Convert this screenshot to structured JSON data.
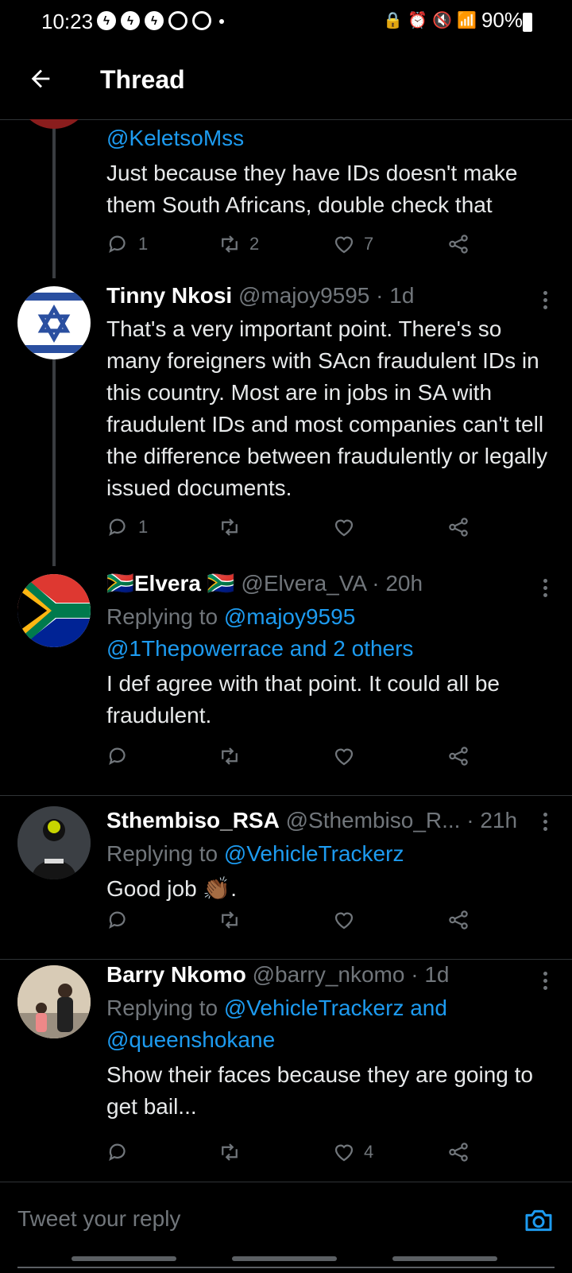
{
  "status": {
    "time": "10:23",
    "battery": "90%"
  },
  "header": {
    "title": "Thread"
  },
  "tweets": [
    {
      "reply_to": "@KeletsoMss",
      "body": "Just because they have IDs doesn't make them South Africans, double check that",
      "replies": "1",
      "retweets": "2",
      "likes": "7"
    },
    {
      "name": "Tinny Nkosi",
      "handle_time": "@majoy9595 · 1d",
      "body": "That's a very important point. There's so many foreigners with SAcn fraudulent IDs in this country. Most are in jobs in SA with fraudulent IDs and most companies can't tell the difference between fraudulently or legally issued documents.",
      "replies": "1",
      "retweets": "",
      "likes": ""
    },
    {
      "name": "Elvera",
      "handle_time": "@Elvera_VA · 20h",
      "reply_prefix": "Replying to ",
      "reply_link1": "@majoy9595",
      "reply_link2": "@1Thepowerrace and 2 others",
      "body": "I def agree with that point. It could all be fraudulent.",
      "replies": "",
      "retweets": "",
      "likes": ""
    },
    {
      "name": "Sthembiso_RSA",
      "handle_time": "@Sthembiso_R... · 21h",
      "reply_prefix": "Replying to ",
      "reply_link1": "@VehicleTrackerz",
      "body": "Good job 👏🏾.",
      "replies": "",
      "retweets": "",
      "likes": ""
    },
    {
      "name": "Barry Nkomo",
      "handle_time": "@barry_nkomo · 1d",
      "reply_prefix": "Replying to ",
      "reply_link1": "@VehicleTrackerz and",
      "reply_link2": "@queenshokane",
      "body": "Show their faces because they are going to get bail...",
      "replies": "",
      "retweets": "",
      "likes": "4"
    }
  ],
  "composer": {
    "placeholder": "Tweet your reply"
  },
  "colors": {
    "accent": "#1d9bf0",
    "muted": "#71767b",
    "background": "#000000"
  },
  "icons": [
    "back-arrow-icon",
    "reply-icon",
    "retweet-icon",
    "like-icon",
    "share-icon",
    "more-icon",
    "camera-icon"
  ]
}
